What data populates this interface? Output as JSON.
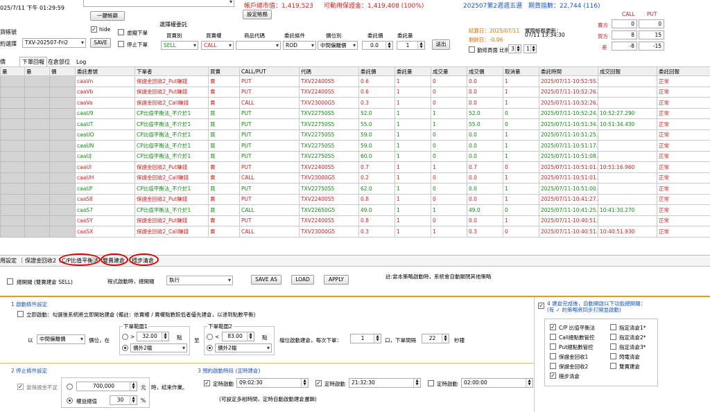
{
  "top": {
    "datetime": "025/7/11 下午 01:29:59",
    "one_click_button": "一鍵帳籍",
    "account_label": "貨帳號",
    "hide_label": "hide",
    "contract_label": "約選擇",
    "contract_value": "TXV-202507-Fri2",
    "save_button": "SAVE",
    "virtual_order_label": "虛擬下單",
    "stop_order_label": "停止下單",
    "account_value_text": "帳戶總市值：1,419,523",
    "available_margin_text": "可動用保證金：1,419,408 (100%)",
    "settings_button": "設定帳務",
    "week_info": "202507第2週週五選",
    "futures_index": "期貨指數：22,744 (116)",
    "select_entrust_title": "選擇權委託",
    "entrust_headers": [
      "買賣別",
      "買賣權",
      "商品代碼",
      "委託條件",
      "價位別",
      "委託價",
      "委託量"
    ],
    "side_value": "SELL",
    "cp_value": "CALL",
    "product_value": "",
    "condition_value": "ROD",
    "price_type_value": "中間偏離價",
    "price_value": "0.0",
    "qty_value": "1",
    "send_button": "送出",
    "settle_date": "結算日：2025/07/11",
    "remain_days": "剩餘日：-0.06",
    "realtime_update_label": "實際帳務更新：",
    "realtime_update_time": "07/11 13:34:30",
    "auto_refresh_label": "勤修頁面 比例",
    "auto_refresh_v1": "3",
    "auto_refresh_v2": "1",
    "cp_table": {
      "headers": [
        "CALL",
        "PUT"
      ],
      "rows": [
        {
          "label": "賣方",
          "call": "0",
          "put": "0"
        },
        {
          "label": "買方",
          "call": "8",
          "put": "15"
        },
        {
          "label": "差",
          "call": "-8",
          "put": "-15"
        }
      ]
    }
  },
  "tabs": [
    "價",
    "下單回報",
    "在倉部位",
    "Log"
  ],
  "grid": {
    "headers": [
      "量",
      "量",
      "價",
      "委託書號",
      "下單者",
      "買賣",
      "CALL/PUT",
      "代碼",
      "委託價",
      "委託量",
      "成交量",
      "成交價",
      "取消量",
      "委託時間",
      "成交回報",
      "委託回報"
    ],
    "rows": [
      {
        "c": "rr",
        "cells": [
          "caaVn",
          "保證金回收2_Put賺錢",
          "賣",
          "PUT",
          "TXV22400S5",
          "0.6",
          "1",
          "0",
          "0.0",
          "1",
          "2025/07/11-10:52:55....",
          "",
          "正常"
        ]
      },
      {
        "c": "rr",
        "cells": [
          "caaVb",
          "保證金回收2_Put賺錢",
          "賣",
          "PUT",
          "TXV22400S5",
          "0.6",
          "1",
          "0",
          "0.0",
          "1",
          "2025/07/11-10:52:26....",
          "",
          "正常"
        ]
      },
      {
        "c": "rr",
        "cells": [
          "caaVa",
          "保證金回收2_Call賺錢",
          "賣",
          "CALL",
          "TXV23000G5",
          "0.3",
          "1",
          "0",
          "0.0",
          "1",
          "2025/07/11-10:52:26....",
          "",
          "正常"
        ]
      },
      {
        "c": "gr",
        "cells": [
          "caaU9",
          "CP比值平衡法_不介於1",
          "買",
          "PUT",
          "TXV22750S5",
          "52.0",
          "1",
          "1",
          "52.0",
          "0",
          "2025/07/11-10:52:24....",
          "10:52:27.290",
          "正常"
        ]
      },
      {
        "c": "gr",
        "cells": [
          "caaUT",
          "CP比值平衡法_不介於1",
          "買",
          "PUT",
          "TXV22750S5",
          "55.0",
          "1",
          "1",
          "55.0",
          "0",
          "2025/07/11-10:51:34....",
          "10:51:34.430",
          "正常"
        ]
      },
      {
        "c": "gr",
        "cells": [
          "caaUO",
          "CP比值平衡法_不介於1",
          "買",
          "PUT",
          "TXV22750S5",
          "59.0",
          "1",
          "0",
          "0.0",
          "1",
          "2025/07/11-10:51:25....",
          "",
          "正常"
        ]
      },
      {
        "c": "gr",
        "cells": [
          "caaUN",
          "CP比值平衡法_不介於1",
          "買",
          "PUT",
          "TXV22750S5",
          "59.0",
          "1",
          "0",
          "0.0",
          "1",
          "2025/07/11-10:51:17....",
          "",
          "正常"
        ]
      },
      {
        "c": "gr",
        "cells": [
          "caaUJ",
          "CP比值平衡法_不介於1",
          "買",
          "PUT",
          "TXV22750S5",
          "60.0",
          "1",
          "0",
          "0.0",
          "1",
          "2025/07/11-10:51:08....",
          "",
          "正常"
        ]
      },
      {
        "c": "rr",
        "cells": [
          "caaUI",
          "保證金回收2_Put賺錢",
          "賣",
          "PUT",
          "TXV22400S5",
          "0.7",
          "1",
          "1",
          "0.7",
          "0",
          "2025/07/11-10:51:01....",
          "10:51:16.960",
          "正常"
        ]
      },
      {
        "c": "rr",
        "cells": [
          "caaUH",
          "保證金回收2_Call賺錢",
          "賣",
          "CALL",
          "TXV23000G5",
          "0.2",
          "1",
          "0",
          "0.0",
          "1",
          "2025/07/11-10:51:01....",
          "",
          "正常"
        ]
      },
      {
        "c": "gr",
        "cells": [
          "caaUF",
          "CP比值平衡法_不介於1",
          "買",
          "PUT",
          "TXV22750S5",
          "62.0",
          "1",
          "0",
          "0.0",
          "1",
          "2025/07/11-10:51:00....",
          "",
          "正常"
        ]
      },
      {
        "c": "rr",
        "cells": [
          "caaS8",
          "保證金回收2_Put賺錢",
          "賣",
          "PUT",
          "TXV22400S5",
          "0.8",
          "1",
          "0",
          "0.0",
          "1",
          "2025/07/11-10:41:27....",
          "",
          "正常"
        ]
      },
      {
        "c": "gr",
        "cells": [
          "caaS7",
          "CP比值平衡法_不介於1",
          "買",
          "CALL",
          "TXV22650G5",
          "49.0",
          "1",
          "1",
          "49.0",
          "0",
          "2025/07/11-10:41:25....",
          "10:41:30.270",
          "正常"
        ]
      },
      {
        "c": "rr",
        "cells": [
          "caaSY",
          "保證金回收2_Put賺錢",
          "賣",
          "PUT",
          "TXV22400S5",
          "0.8",
          "1",
          "0",
          "0.0",
          "1",
          "2025/07/11-10:40:51....",
          "",
          "正常"
        ]
      },
      {
        "c": "rr",
        "cells": [
          "caaSX",
          "保證金回收2_Call賺錢",
          "賣",
          "CALL",
          "TXV23000G5",
          "0.3",
          "1",
          "1",
          "0.3",
          "0",
          "2025/07/11-10:40:51....",
          "10:40:51.930",
          "正常"
        ]
      }
    ]
  },
  "strategy_tabs": [
    "用設定",
    "保證金回收2",
    "C/P比值平衡法",
    "雙賣建倉",
    "穩步清倉"
  ],
  "controls": {
    "master_switch_label": "總開關 (雙賣建倉 SELL)",
    "strategy_switch_label": "程式啟動時，總開關",
    "strategy_switch_value": "執行",
    "save_as": "SAVE AS",
    "load": "LOAD",
    "apply": "APPLY",
    "note": "註:當本策略啟動時，系統會自動關閉其他策略"
  },
  "section1": {
    "title": "1 啟動條件設定",
    "immediate_label": "立即啟動：勾選後系統將立即開始建倉 (備註：依賣權 / 賣權點數較低者優先建倉，以達到點數平衡)",
    "by_label": "以",
    "price_ref": "中間偏離價",
    "position_at": "價位，在",
    "range1_title": "下單範圍1",
    "range1_op": ">",
    "range1_val": "32.00",
    "range1_unit": "點",
    "range1_sel": "價外2檔",
    "to_label": "至",
    "range2_title": "下單範圍2",
    "range2_op": "<",
    "range2_val": "83.00",
    "range2_unit": "點",
    "range2_sel": "價外2檔",
    "position_build_label": "檔位啟動建倉，每次下單：",
    "order_qty": "1",
    "order_unit": "口，下單間隔",
    "interval": "22",
    "interval_unit": "秒鐘"
  },
  "section2": {
    "title": "2 停止條件設定",
    "margin_label": "當保證金不足",
    "margin_value": "700,000",
    "margin_unit": "元",
    "stop_text": "時，結束作業。",
    "equity_label": "權益總值",
    "equity_value": "30",
    "equity_unit": "%"
  },
  "section3": {
    "title": "3 預約啟動時段 (定時建倉)",
    "t1_label": "定時啟動",
    "t1": "09:02:30",
    "t2_label": "定時啟動",
    "t2": "21:32:30",
    "t3_label": "定時啟動",
    "t3": "02:00:00",
    "hint": "(可設定多組時間，定時自動啟動建倉邏輯)"
  },
  "section4": {
    "title": "4 建倉完成後，自動開啟以下功能總開關：",
    "subtitle": "(有 ✓ 的策略將同步打開並啟動)",
    "left": [
      {
        "label": "C/P 比值平衡法",
        "checked": true
      },
      {
        "label": "Call總點數管控",
        "checked": false
      },
      {
        "label": "Put總點數管控",
        "checked": false
      },
      {
        "label": "保證金回收1",
        "checked": false
      },
      {
        "label": "保證金回收2",
        "checked": false
      },
      {
        "label": "穩步清倉",
        "checked": true
      }
    ],
    "right": [
      {
        "label": "指定清倉1*",
        "checked": false
      },
      {
        "label": "指定清倉2*",
        "checked": false
      },
      {
        "label": "指定清倉3*",
        "checked": false
      },
      {
        "label": "閃電清倉",
        "checked": false
      },
      {
        "label": "雙賣建倉",
        "checked": false
      }
    ]
  }
}
